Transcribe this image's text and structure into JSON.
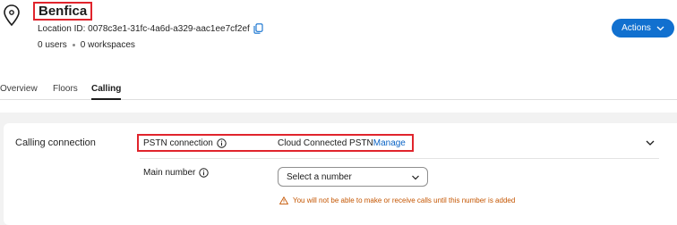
{
  "location": {
    "name": "Benfica",
    "id_label": "Location ID: 0078c3e1-31fc-4a6d-a329-aac1ee7cf2ef",
    "users": "0 users",
    "workspaces": "0 workspaces"
  },
  "header": {
    "actions_label": "Actions"
  },
  "tabs": [
    {
      "label": "Overview",
      "active": false
    },
    {
      "label": "Floors",
      "active": false
    },
    {
      "label": "Calling",
      "active": true
    }
  ],
  "calling": {
    "section_title": "Calling connection",
    "pstn_label": "PSTN connection",
    "pstn_value": "Cloud Connected PSTN",
    "manage_label": "Manage",
    "main_number_label": "Main number",
    "select_value": "Select a number",
    "warning_text": "You will not be able to make or receive calls until this number is added"
  },
  "colors": {
    "accent": "#1170cf",
    "highlight_border": "#e0242c",
    "warning": "#c45500"
  }
}
